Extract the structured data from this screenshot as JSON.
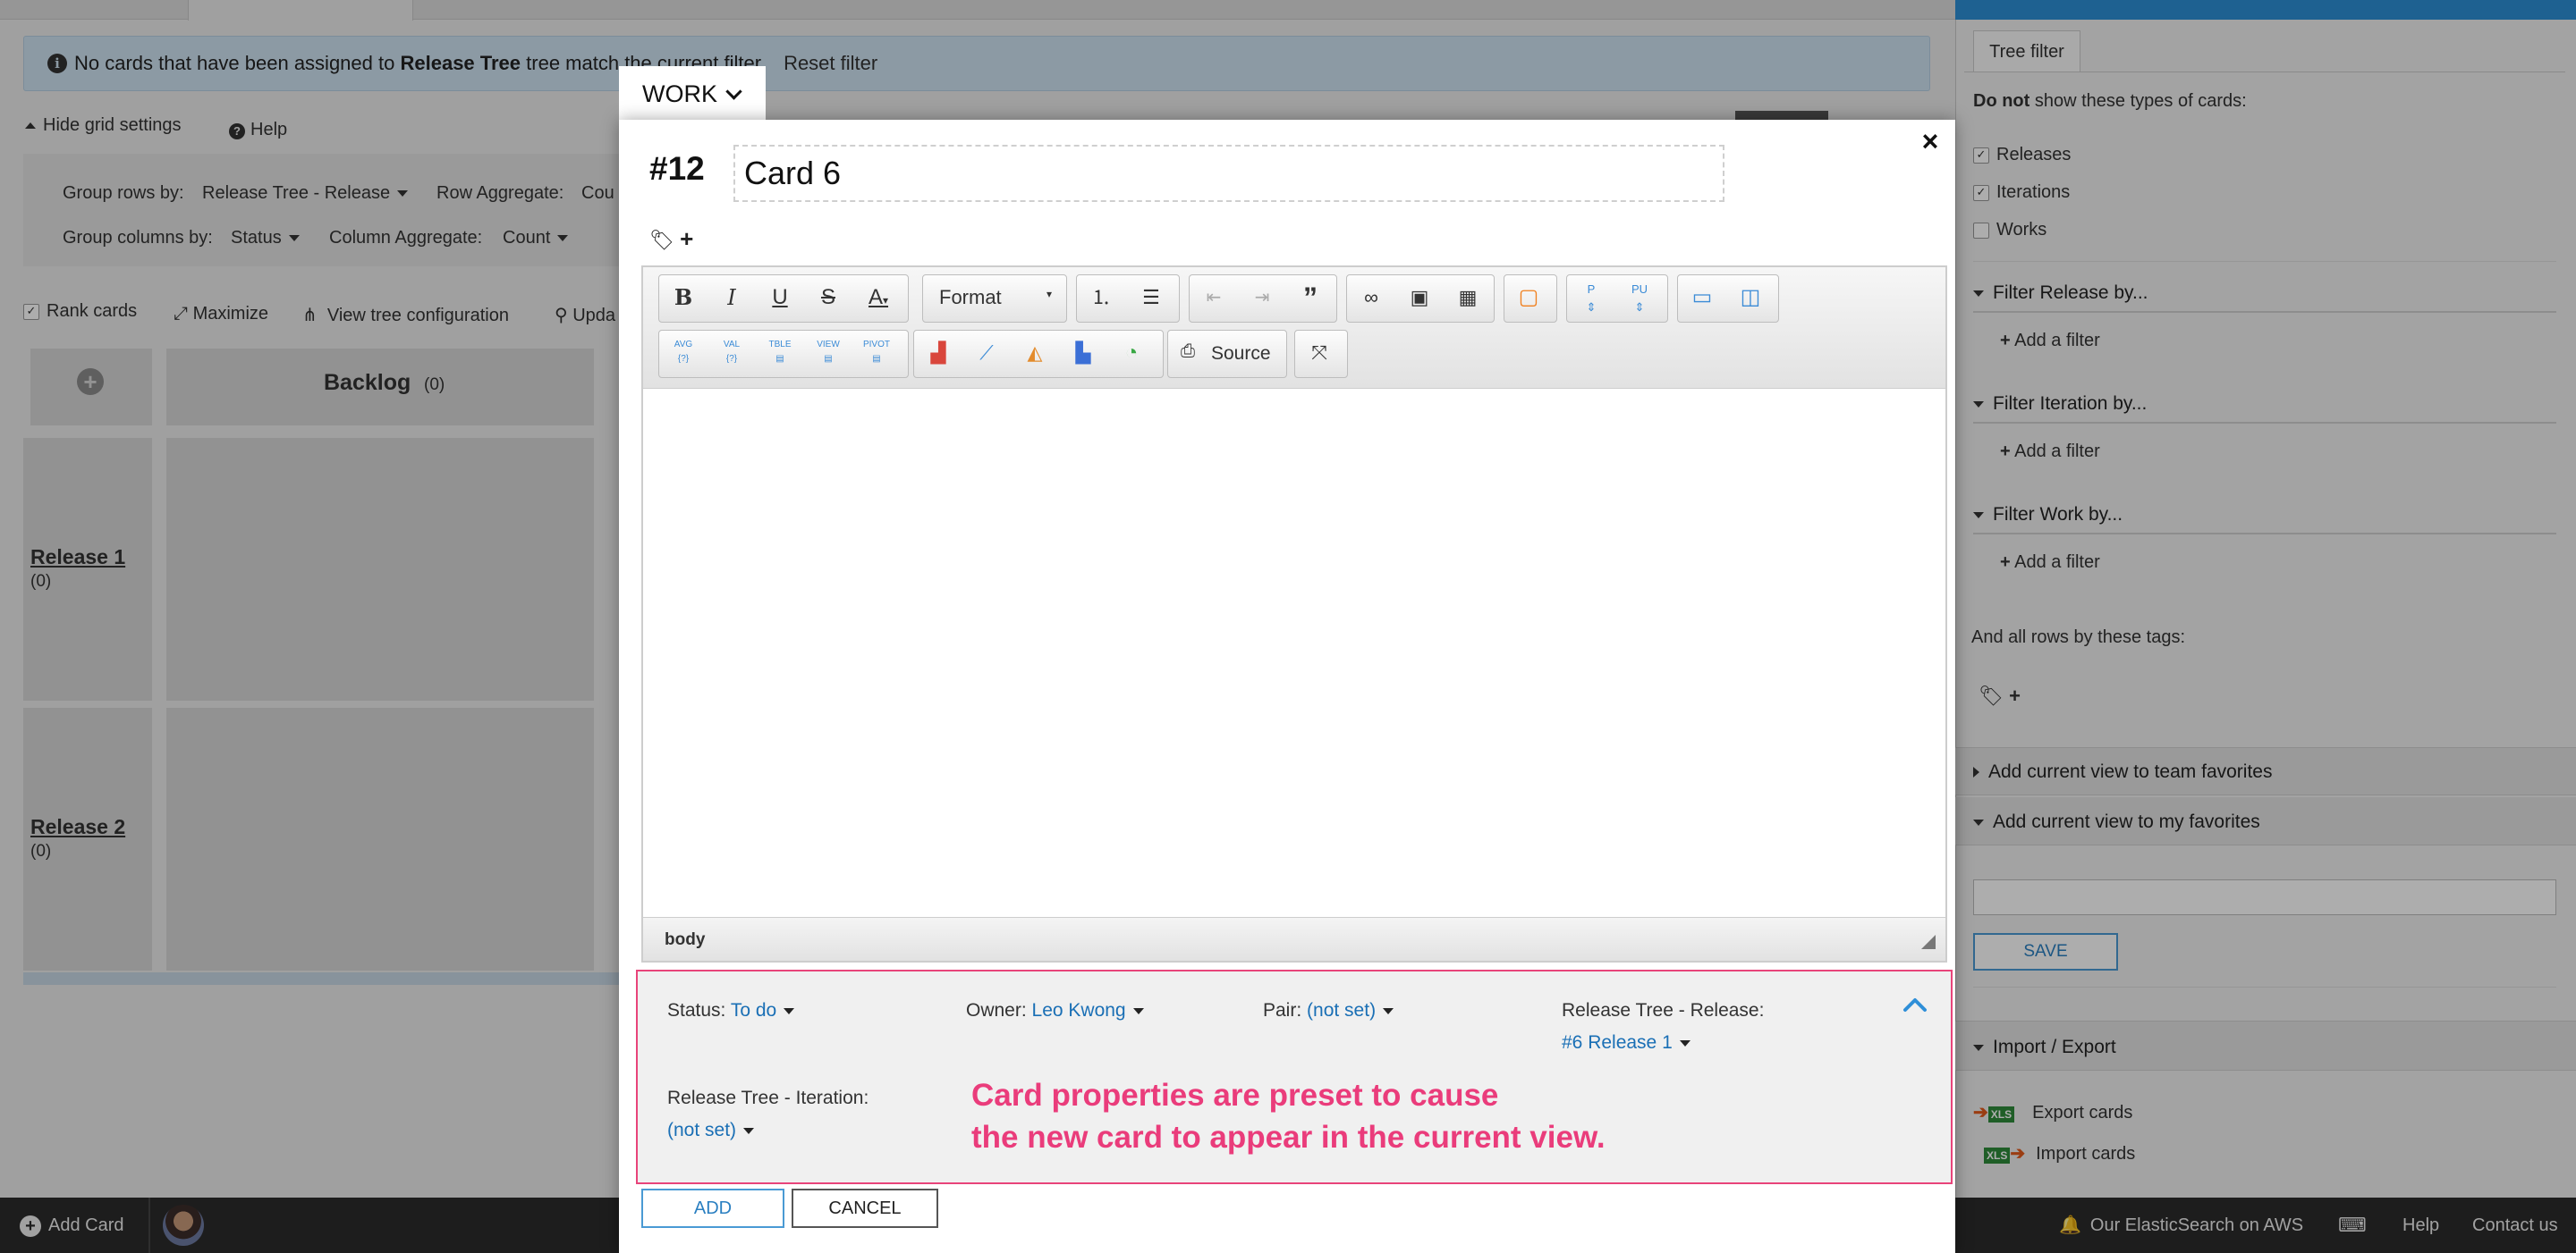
{
  "alert": {
    "text_prefix": "No cards that have been assigned to",
    "bold": "Release Tree",
    "text_suffix": "tree match the current filter.",
    "reset_link": "Reset filter"
  },
  "grid_controls": {
    "hide_settings": "Hide grid settings",
    "help": "Help",
    "group_rows_label": "Group rows by:",
    "group_rows_value": "Release Tree - Release",
    "row_aggregate_label": "Row Aggregate:",
    "row_aggregate_value": "Cou",
    "group_columns_label": "Group columns by:",
    "group_columns_value": "Status",
    "column_aggregate_label": "Column Aggregate:",
    "column_aggregate_value": "Count",
    "rank_cards": "Rank cards",
    "maximize": "Maximize",
    "view_tree_config": "View tree configuration",
    "update": "Upda"
  },
  "board": {
    "backlog_label": "Backlog",
    "backlog_count": "(0)",
    "rows": [
      {
        "label": "Release 1",
        "count": "(0)"
      },
      {
        "label": "Release 2",
        "count": "(0)"
      }
    ]
  },
  "modal": {
    "type": "WORK",
    "card_number": "#12",
    "title": "Card 6",
    "editor": {
      "format_label": "Format",
      "source_label": "Source",
      "status_path": "body",
      "buttons": [
        "bold",
        "italic",
        "underline",
        "strikethrough",
        "text-color",
        "numbered-list",
        "bulleted-list",
        "decrease-indent",
        "increase-indent",
        "blockquote",
        "link",
        "image",
        "table",
        "iframe",
        "page-break-p",
        "page-break-pu",
        "maximize-view",
        "show-blocks",
        "agg-field",
        "val-field",
        "table-field",
        "view-field",
        "pivot-field",
        "bar-chart",
        "line-chart",
        "area-chart",
        "column-chart",
        "pie-chart",
        "source",
        "fullscreen"
      ]
    },
    "properties": {
      "status_label": "Status:",
      "status_value": "To do",
      "owner_label": "Owner:",
      "owner_value": "Leo Kwong",
      "pair_label": "Pair:",
      "pair_value": "(not set)",
      "release_label": "Release Tree - Release:",
      "release_value": "#6 Release 1",
      "iteration_label": "Release Tree - Iteration:",
      "iteration_value": "(not set)"
    },
    "annotation_line1": "Card properties are preset to cause",
    "annotation_line2": "the new card to appear in the current view.",
    "add_button": "ADD",
    "cancel_button": "CANCEL"
  },
  "right_panel": {
    "tab": "Tree filter",
    "do_not_bold": "Do not",
    "do_not_rest": "show these types of cards:",
    "types": [
      {
        "label": "Releases",
        "checked": true
      },
      {
        "label": "Iterations",
        "checked": true
      },
      {
        "label": "Works",
        "checked": false
      }
    ],
    "filter_release": "Filter Release by...",
    "filter_iteration": "Filter Iteration by...",
    "filter_work": "Filter Work by...",
    "add_filter": "Add a filter",
    "tags_label": "And all rows by these tags:",
    "team_favorites": "Add current view to team favorites",
    "my_favorites": "Add current view to my favorites",
    "save_button": "SAVE",
    "import_export": "Import / Export",
    "export_cards": "Export cards",
    "import_cards": "Import cards",
    "xls_badge": "XLS"
  },
  "bottom_bar": {
    "add_card": "Add Card",
    "elastic": "Our ElasticSearch on AWS",
    "help": "Help",
    "contact": "Contact us"
  },
  "colors": {
    "accent_blue": "#1a6fb5",
    "annotation_pink": "#ea3c7b",
    "props_border": "#e8447a"
  }
}
